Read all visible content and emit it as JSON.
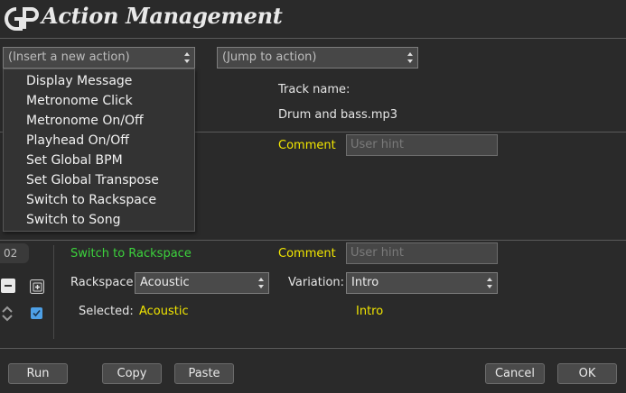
{
  "window": {
    "title": "Action Management"
  },
  "toolbar": {
    "insert_action_placeholder": "(Insert a new action)",
    "jump_action_placeholder": "(Jump to action)"
  },
  "insert_menu": {
    "items": [
      "Display Message",
      "Metronome Click",
      "Metronome On/Off",
      "Playhead On/Off",
      "Set Global BPM",
      "Set Global Transpose",
      "Switch to Rackspace",
      "Switch to Song"
    ]
  },
  "action_01": {
    "track_name_label": "Track name:",
    "track_name_value": "Drum and bass.mp3",
    "comment_label": "Comment",
    "comment_placeholder": "User hint"
  },
  "action_02": {
    "index": "02",
    "type": "Switch to Rackspace",
    "comment_label": "Comment",
    "comment_placeholder": "User hint",
    "rackspace_label": "Rackspace:",
    "rackspace_value": "Acoustic",
    "variation_label": "Variation:",
    "variation_value": "Intro",
    "selected_label": "Selected:",
    "selected_rackspace": "Acoustic",
    "selected_variation": "Intro"
  },
  "footer": {
    "run": "Run",
    "copy": "Copy",
    "paste": "Paste",
    "cancel": "Cancel",
    "ok": "OK"
  },
  "colors": {
    "background": "#2a2a2a",
    "accent_yellow": "#f2e600",
    "accent_green": "#3cd23c",
    "checkbox_blue": "#4ea0e6"
  }
}
